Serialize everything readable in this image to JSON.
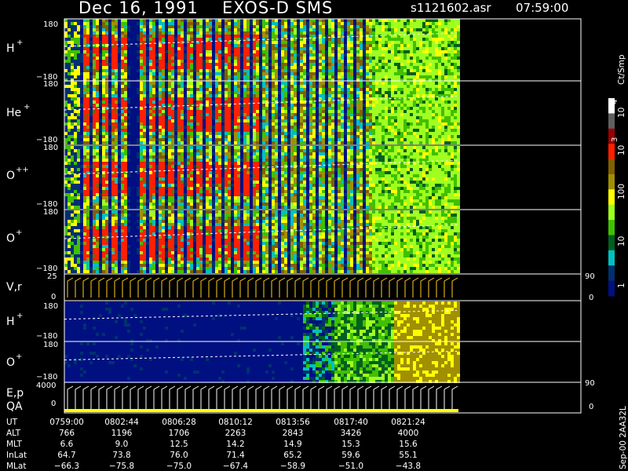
{
  "header": {
    "date": "Dec 16, 1991",
    "instrument": "EXOS-D SMS",
    "filename": "s1121602.asr",
    "time": "07:59:00"
  },
  "colorbar": {
    "unit": "Ct/Smp",
    "labels": [
      "10",
      "4",
      "10",
      "3",
      "100",
      "10",
      "1"
    ],
    "colors": [
      "#ffffff",
      "#606060",
      "#9a0000",
      "#ff2000",
      "#806000",
      "#a09000",
      "#ffff00",
      "#a0ff20",
      "#40c000",
      "#006020",
      "#00c0c0",
      "#003070",
      "#001080"
    ]
  },
  "panels": [
    {
      "label": "H",
      "sup": "+",
      "ymax": "180",
      "ymin": "−180"
    },
    {
      "label": "He",
      "sup": "+",
      "ymax": "180",
      "ymin": "−180"
    },
    {
      "label": "O",
      "sup": "++",
      "ymax": "180",
      "ymin": "−180"
    },
    {
      "label": "O",
      "sup": "+",
      "ymax": "180",
      "ymin": "−180"
    },
    {
      "label": "V,r",
      "sup": "",
      "ymax": "25",
      "ymin": "0",
      "rmax": "90",
      "rmin": "0"
    },
    {
      "label": "H",
      "sup": "+",
      "ymax": "180",
      "ymin": "−180"
    },
    {
      "label": "O",
      "sup": "+",
      "ymax": "180",
      "ymin": "−180"
    },
    {
      "label": "E,p",
      "sup": "",
      "label2": "QA",
      "ymax": "4000",
      "ymin": "0",
      "rmax": "90",
      "rmin": "0"
    }
  ],
  "footer": {
    "rows": [
      {
        "name": "UT",
        "values": [
          "0759:00",
          "0802:44",
          "0806:28",
          "0810:12",
          "0813:56",
          "0817:40",
          "0821:24"
        ]
      },
      {
        "name": "ALT",
        "values": [
          "766",
          "1196",
          "1706",
          "2263",
          "2843",
          "3426",
          "4000"
        ]
      },
      {
        "name": "MLT",
        "values": [
          "6.6",
          "9.0",
          "12.5",
          "14.2",
          "14.9",
          "15.3",
          "15.6"
        ]
      },
      {
        "name": "InLat",
        "values": [
          "64.7",
          "73.8",
          "76.0",
          "71.4",
          "65.2",
          "59.6",
          "55.1"
        ]
      },
      {
        "name": "MLat",
        "values": [
          "−66.3",
          "−75.8",
          "−75.0",
          "−67.4",
          "−58.9",
          "−51.0",
          "−43.8"
        ]
      }
    ],
    "stamp": "Sep-00 2AA32L"
  }
}
